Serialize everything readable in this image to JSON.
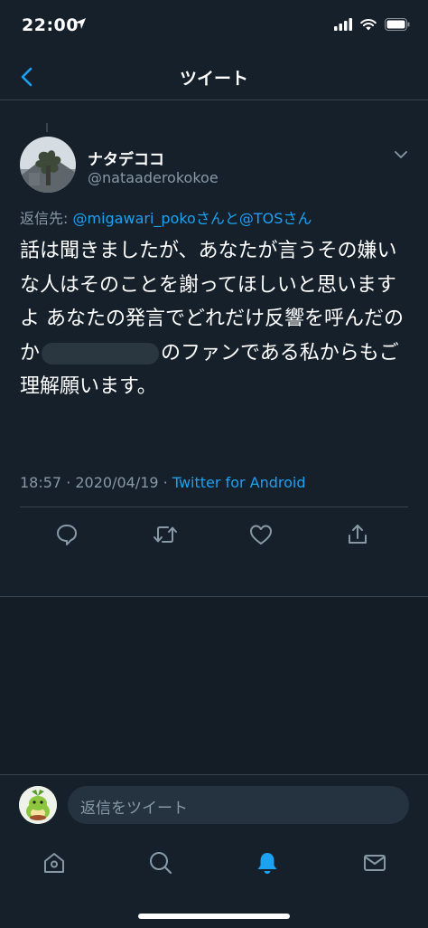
{
  "status": {
    "time": "22:00"
  },
  "nav": {
    "title": "ツイート"
  },
  "tweet": {
    "display_name": "ナタデココ",
    "handle": "@nataaderokokoe",
    "reply_prefix": "返信先: ",
    "reply_mention_1": "@migawari_poko",
    "reply_joiner": "さんと",
    "reply_mention_2": "@TOS",
    "reply_suffix": "さん",
    "text_before_redaction": "話は聞きましたが、あなたが言うその嫌いな人はそのことを謝ってほしいと思いますよ あなたの発言でどれだけ反響を呼んだのか",
    "text_after_redaction": "のファンである私からもご理解願います。",
    "time": "18:57 · 2020/04/19 · ",
    "source": "Twitter for Android"
  },
  "reply_bar": {
    "placeholder": "返信をツイート"
  },
  "icons": {
    "back": "back-chevron-icon",
    "reply": "reply-icon",
    "retweet": "retweet-icon",
    "like": "heart-icon",
    "share": "share-icon",
    "home": "home-icon",
    "search": "search-icon",
    "notifications": "bell-icon",
    "messages": "mail-icon"
  },
  "colors": {
    "background": "#15202b",
    "accent": "#1da1f2",
    "secondary_text": "#8899a6",
    "divider": "#38444d"
  }
}
